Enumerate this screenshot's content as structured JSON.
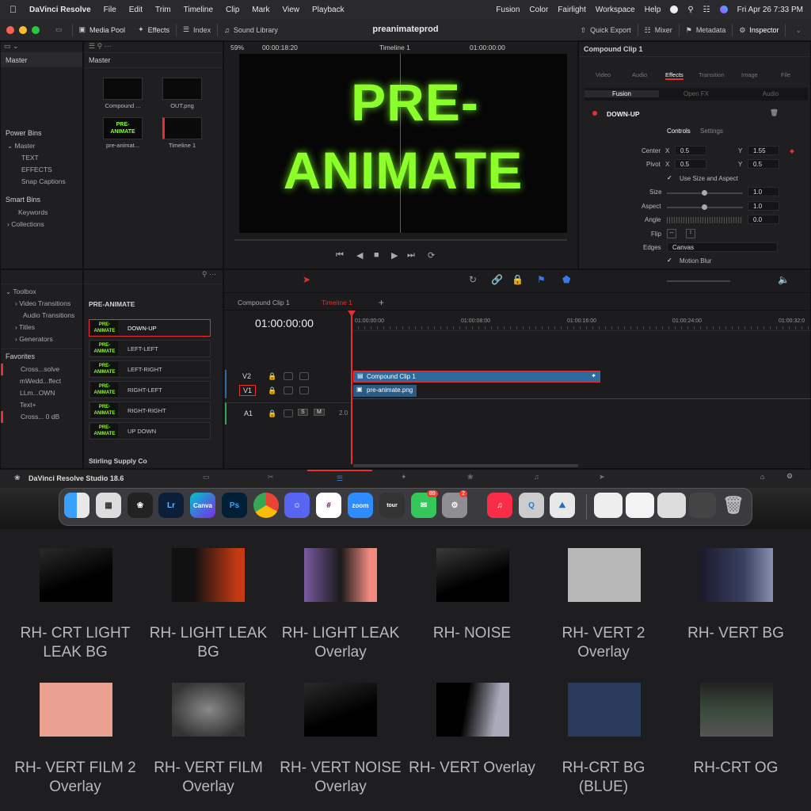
{
  "menubar": {
    "app_name": "DaVinci Resolve",
    "items": [
      "File",
      "Edit",
      "Trim",
      "Timeline",
      "Clip",
      "Mark",
      "View",
      "Playback"
    ],
    "right_items": [
      "Fusion",
      "Color",
      "Fairlight",
      "Workspace",
      "Help"
    ],
    "datetime": "Fri Apr 26  7:33 PM"
  },
  "toolbar": {
    "media_pool": "Media Pool",
    "effects": "Effects",
    "index": "Index",
    "sound_library": "Sound Library",
    "project_title": "preanimateprod",
    "quick_export": "Quick Export",
    "mixer": "Mixer",
    "metadata": "Metadata",
    "inspector": "Inspector"
  },
  "media_pool": {
    "bin_header": "Master",
    "master_label": "Master",
    "power_bins_label": "Power Bins",
    "power_bins": [
      "Master",
      "TEXT",
      "EFFECTS",
      "Snap Captions"
    ],
    "smart_bins_label": "Smart Bins",
    "smart_bins": [
      "Keywords",
      "Collections"
    ],
    "clips": [
      {
        "name": "Compound ..."
      },
      {
        "name": "OUT.png"
      },
      {
        "name": "pre-animat..."
      },
      {
        "name": "Timeline 1"
      }
    ]
  },
  "viewer": {
    "zoom": "59%",
    "timecode_left": "00:00:18:20",
    "timeline_name": "Timeline 1",
    "timecode_right": "01:00:00:00",
    "title_line1": "PRE-",
    "title_line2": "ANIMATE"
  },
  "effects_panel": {
    "toolbox_items": [
      "Toolbox",
      "Video Transitions",
      "Audio Transitions",
      "Titles",
      "Generators"
    ],
    "favorites_label": "Favorites",
    "favorites": [
      "Cross...solve",
      "mWedd...ffect",
      "LLm...OWN",
      "Text+",
      "Cross... 0 dB"
    ],
    "section_title": "PRE-ANIMATE",
    "presets": [
      "DOWN-UP",
      "LEFT-LEFT",
      "LEFT-RIGHT",
      "RIGHT-LEFT",
      "RIGHT-RIGHT",
      "UP DOWN"
    ],
    "thumb_text_1": "PRE-",
    "thumb_text_2": "ANIMATE",
    "section2_title": "Stirling Supply Co"
  },
  "inspector": {
    "clip_title": "Compound Clip 1",
    "tabs": [
      "Video",
      "Audio",
      "Effects",
      "Transition",
      "Image",
      "File"
    ],
    "subtabs": [
      "Fusion",
      "Open FX",
      "Audio"
    ],
    "effect_name": "DOWN-UP",
    "control_tabs": [
      "Controls",
      "Settings"
    ],
    "center_label": "Center",
    "center_x": "0.5",
    "center_y": "1.55",
    "pivot_label": "Pivot",
    "pivot_x": "0.5",
    "pivot_y": "0.5",
    "x_label": "X",
    "y_label": "Y",
    "use_size_aspect": "Use Size and Aspect",
    "size_label": "Size",
    "size_val": "1.0",
    "aspect_label": "Aspect",
    "aspect_val": "1.0",
    "angle_label": "Angle",
    "angle_val": "0.0",
    "flip_label": "Flip",
    "edges_label": "Edges",
    "edges_val": "Canvas",
    "motion_blur": "Motion Blur"
  },
  "timeline": {
    "tabs": [
      "Compound Clip 1",
      "Timeline 1"
    ],
    "timecode": "01:00:00:00",
    "ruler": [
      "01:00:00:00",
      "01:00:08:00",
      "01:00:16:00",
      "01:00:24:00",
      "01:00:32:0"
    ],
    "tracks": [
      "V2",
      "V1",
      "A1"
    ],
    "audio_level": "2.0",
    "clip_v2": "Compound Clip 1",
    "clip_v1": "pre-animate.png"
  },
  "statusbar": {
    "product": "DaVinci Resolve Studio 18.6"
  },
  "dock": {
    "badges": [
      "89",
      "2"
    ]
  },
  "presets_grid": [
    {
      "line1": "RH- CRT LIGHT",
      "line2": "LEAK BG"
    },
    {
      "line1": "RH- LIGHT LEAK",
      "line2": "BG"
    },
    {
      "line1": "RH- LIGHT LEAK",
      "line2": "Overlay"
    },
    {
      "line1": "RH- NOISE",
      "line2": ""
    },
    {
      "line1": "RH- VERT 2",
      "line2": "Overlay"
    },
    {
      "line1": "RH- VERT BG",
      "line2": ""
    },
    {
      "line1": "RH- VERT FILM 2",
      "line2": "Overlay"
    },
    {
      "line1": "RH- VERT FILM",
      "line2": "Overlay"
    },
    {
      "line1": "RH- VERT NOISE",
      "line2": "Overlay"
    },
    {
      "line1": "RH- VERT Overlay",
      "line2": ""
    },
    {
      "line1": "RH-CRT BG",
      "line2": "(BLUE)"
    },
    {
      "line1": "RH-CRT OG",
      "line2": ""
    }
  ],
  "colors": {
    "accent_green": "#8cff2a",
    "clip_blue": "#2c6a9e",
    "playhead_red": "#e53030"
  }
}
